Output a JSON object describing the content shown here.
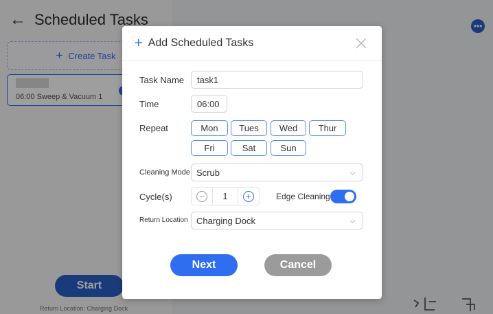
{
  "app": {
    "title": "Scheduled Tasks",
    "create_task_label": "Create Task",
    "task_item": "06:00 Sweep & Vacuum 1",
    "start_label": "Start",
    "return_location_text": "Return Location: Charging Dock"
  },
  "dialog": {
    "title": "Add Scheduled Tasks",
    "task_name_label": "Task Name",
    "task_name_value": "task1",
    "time_label": "Time",
    "time_value": "06:00",
    "repeat_label": "Repeat",
    "days": [
      "Mon",
      "Tues",
      "Wed",
      "Thur",
      "Fri",
      "Sat",
      "Sun"
    ],
    "cleaning_mode_label": "Cleaning Mode",
    "cleaning_mode_value": "Scrub",
    "cycles_label": "Cycle(s)",
    "cycles_value": "1",
    "edge_cleaning_label": "Edge Cleaning",
    "edge_cleaning_on": true,
    "return_location_label": "Return Location",
    "return_location_value": "Charging Dock",
    "next_label": "Next",
    "cancel_label": "Cancel"
  },
  "colors": {
    "accent": "#2f6ef0",
    "cancel": "#9b9b9b",
    "overlay": "rgba(0,0,0,0.38)"
  }
}
